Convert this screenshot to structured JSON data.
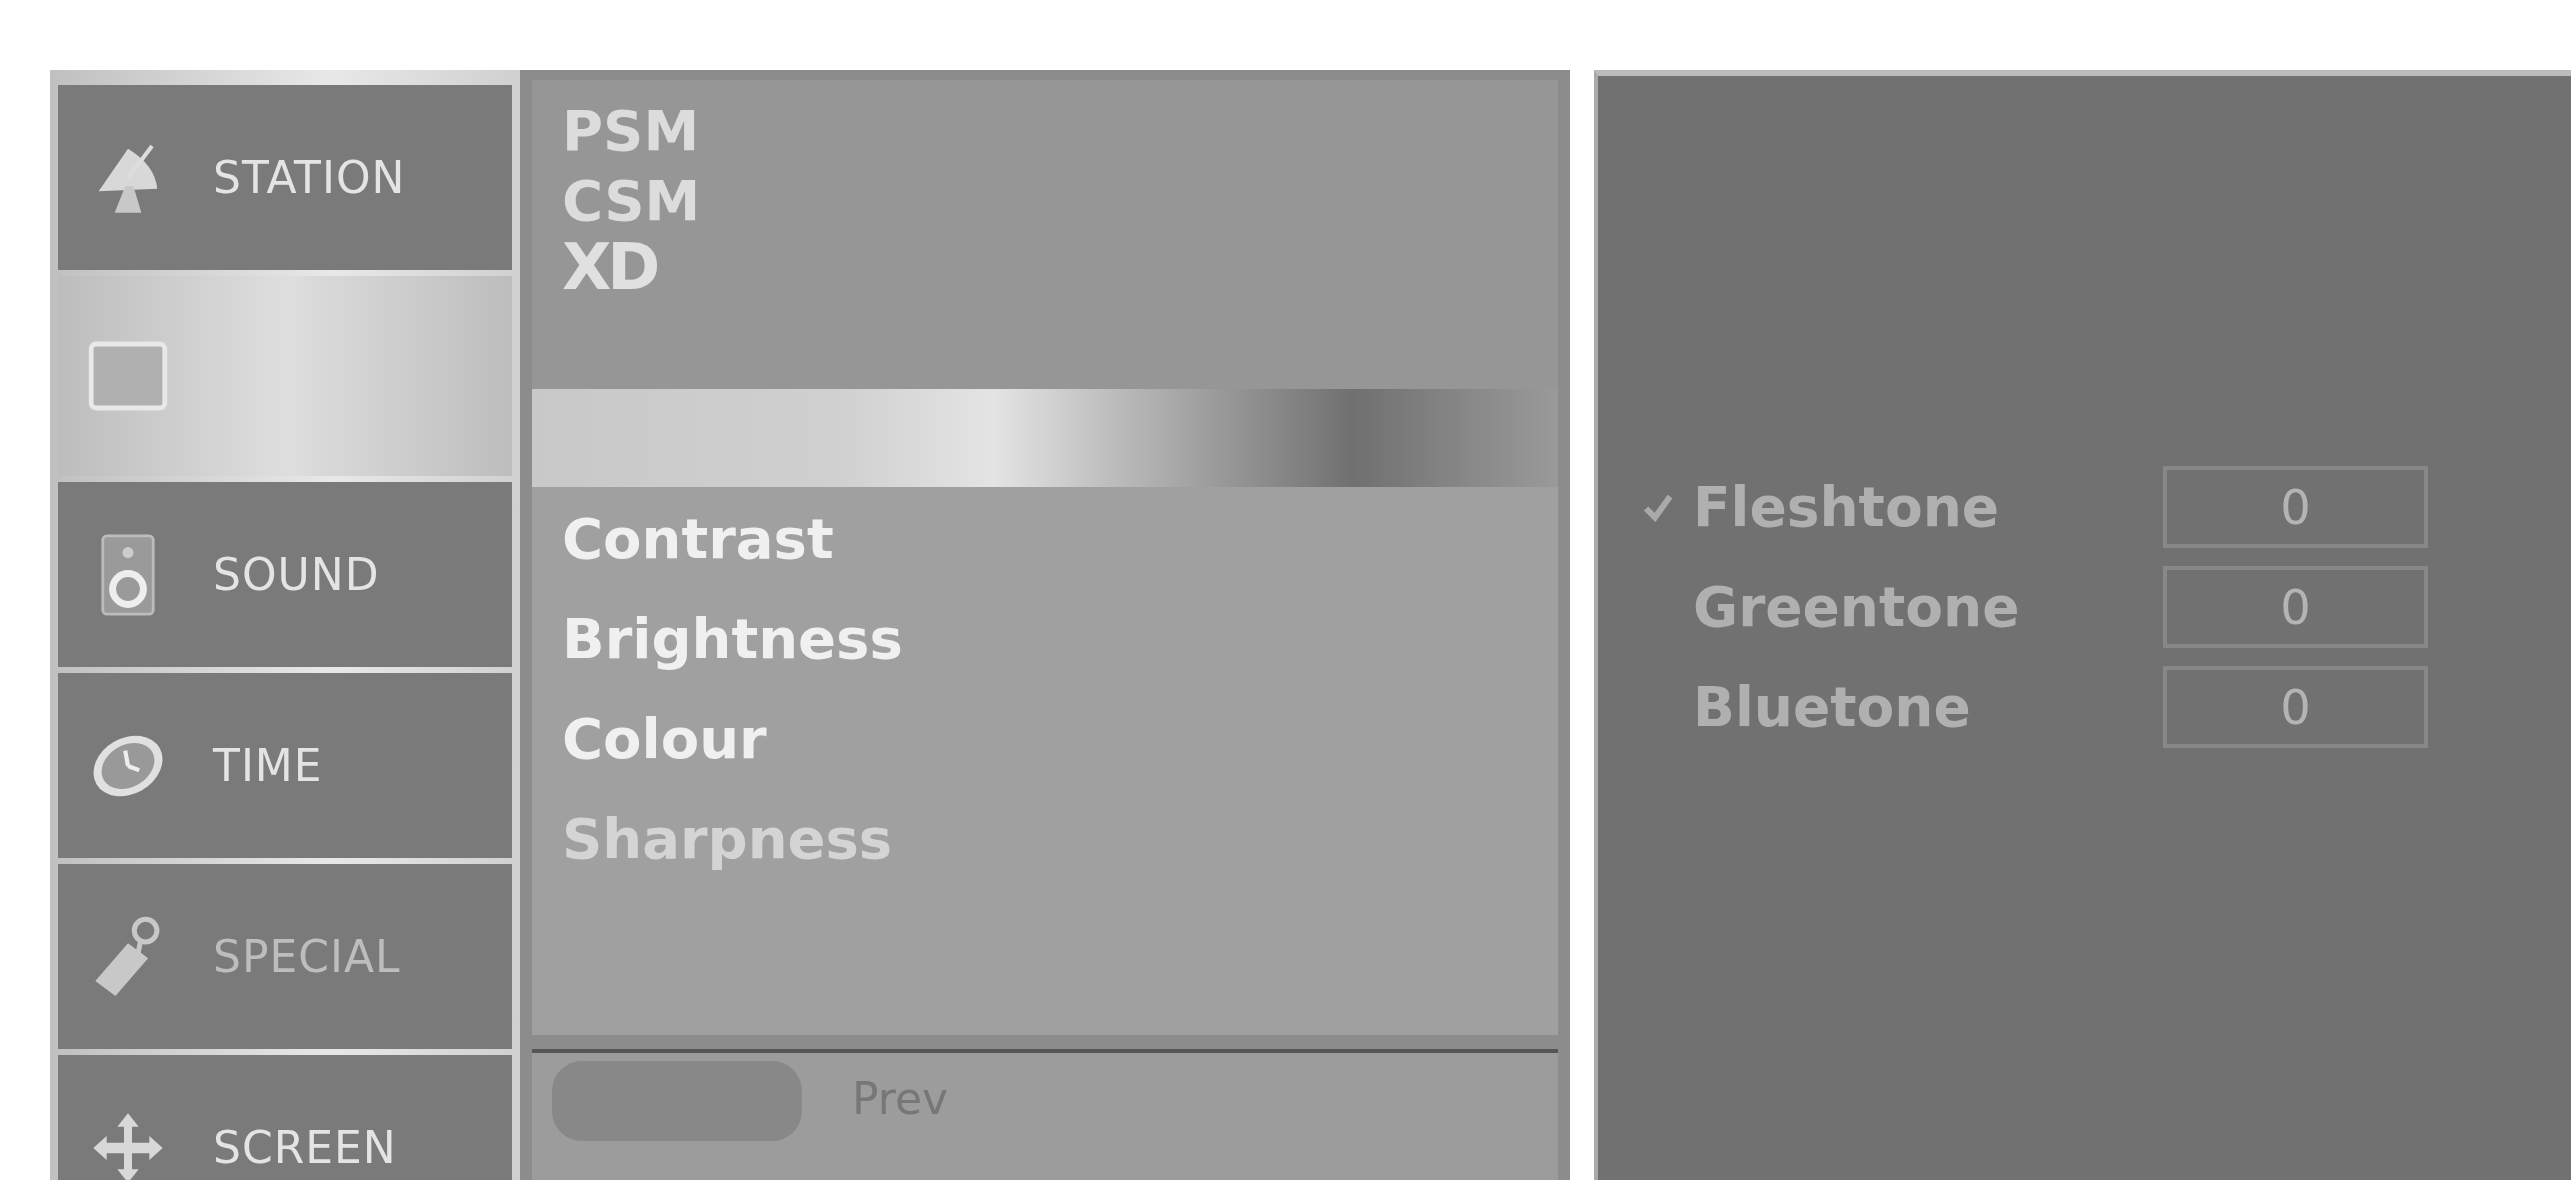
{
  "sidebar": {
    "items": [
      {
        "kind": "station",
        "label": "STATION",
        "selected": false,
        "dimmed": false
      },
      {
        "kind": "picture",
        "selected": true,
        "dimmed": false
      },
      {
        "kind": "sound",
        "label": "SOUND",
        "selected": false,
        "dimmed": false
      },
      {
        "kind": "time",
        "label": "TIME",
        "selected": false,
        "dimmed": false
      },
      {
        "kind": "special",
        "label": "SPECIAL",
        "selected": false,
        "dimmed": true
      },
      {
        "kind": "screen",
        "label": "SCREEN",
        "selected": false,
        "dimmed": false
      }
    ]
  },
  "modes": [
    {
      "label": "PSM",
      "kind": "text"
    },
    {
      "label": "CSM",
      "kind": "text"
    },
    {
      "label": "XD",
      "kind": "logo"
    }
  ],
  "adjustments": [
    {
      "label": "Contrast",
      "dimmed": false
    },
    {
      "label": "Brightness",
      "dimmed": false
    },
    {
      "label": "Colour",
      "dimmed": false
    },
    {
      "label": "Sharpness",
      "dimmed": true
    }
  ],
  "footer": {
    "hint": "Prev"
  },
  "tones": [
    {
      "label": "Fleshtone",
      "value": "0",
      "checked": true
    },
    {
      "label": "Greentone",
      "value": "0",
      "checked": false
    },
    {
      "label": "Bluetone",
      "value": "0",
      "checked": false
    }
  ]
}
